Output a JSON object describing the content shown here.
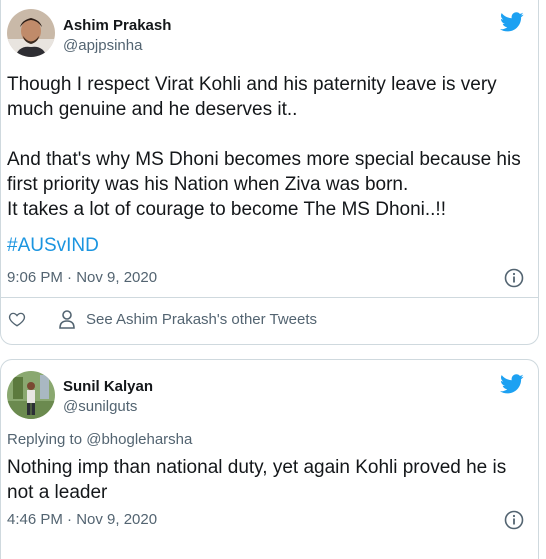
{
  "tweets": [
    {
      "author_name": "Ashim Prakash",
      "author_handle": "@apjpsinha",
      "body_lines": [
        "Though I respect Virat Kohli and his paternity leave is very",
        "much genuine and he deserves it..",
        "",
        "And that's why MS Dhoni becomes more special because his",
        "first priority was his Nation when Ziva was born.",
        "It takes a lot of courage to become The MS Dhoni..!!"
      ],
      "hashtag": "#AUSvIND",
      "timestamp": "9:06 PM · Nov 9, 2020",
      "profile_link": "See Ashim Prakash's other Tweets",
      "icons": [
        "twitter-bird-icon",
        "info-icon",
        "heart-icon",
        "person-icon"
      ]
    },
    {
      "author_name": "Sunil Kalyan",
      "author_handle": "@sunilguts",
      "replying_to_label": "Replying to",
      "replying_to_handle": "@bhogleharsha",
      "body_lines": [
        "Nothing imp than national duty, yet again Kohli proved he is",
        "not a leader"
      ],
      "timestamp": "4:46 PM · Nov 9, 2020",
      "icons": [
        "twitter-bird-icon",
        "info-icon"
      ]
    }
  ],
  "colors": {
    "twitter_blue": "#1da1f2",
    "hashtag_blue": "#1b95e0",
    "secondary_text": "#536471",
    "border": "#cfd9de"
  }
}
